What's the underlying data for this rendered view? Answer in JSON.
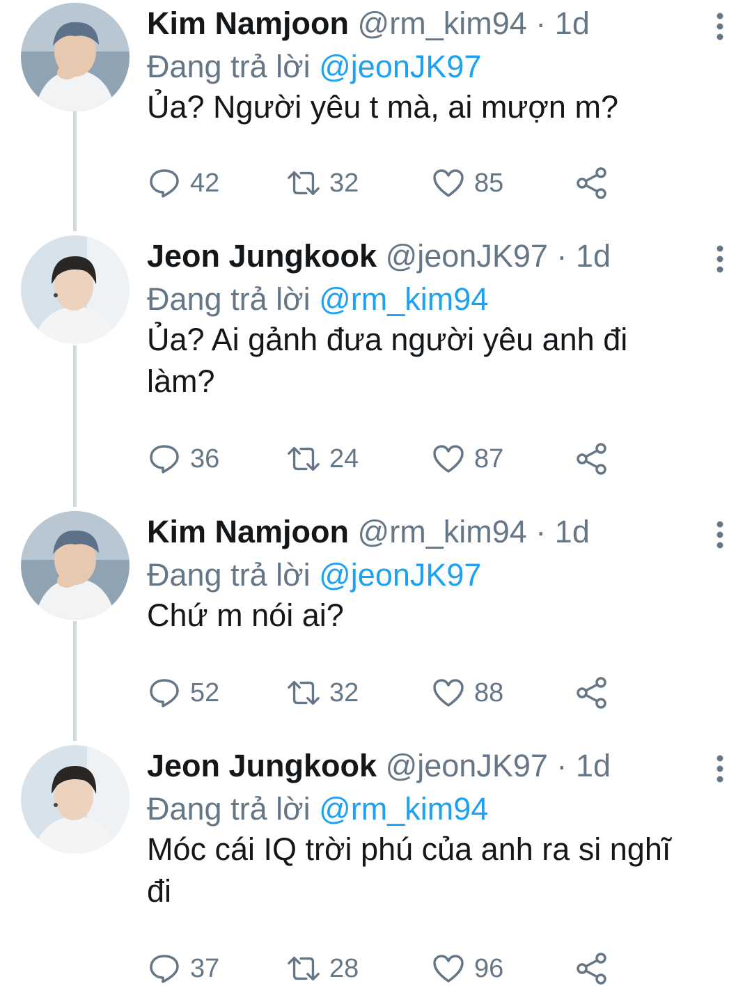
{
  "tweets": [
    {
      "name": "Kim Namjoon",
      "handle": "@rm_kim94",
      "separator": "·",
      "time": "1d",
      "reply_prefix": "Đang trả lời",
      "reply_to": "@jeonJK97",
      "text": "Ủa? Người yêu t mà, ai mượn m?",
      "replies": "42",
      "retweets": "32",
      "likes": "85",
      "avatar": "avatar-namjoon"
    },
    {
      "name": "Jeon Jungkook",
      "handle": "@jeonJK97",
      "separator": "·",
      "time": "1d",
      "reply_prefix": "Đang trả lời",
      "reply_to": "@rm_kim94",
      "text": "Ủa? Ai gảnh đưa người yêu anh đi làm?",
      "replies": "36",
      "retweets": "24",
      "likes": "87",
      "avatar": "avatar-jungkook"
    },
    {
      "name": "Kim Namjoon",
      "handle": "@rm_kim94",
      "separator": "·",
      "time": "1d",
      "reply_prefix": "Đang trả lời",
      "reply_to": "@jeonJK97",
      "text": "Chứ m nói ai?",
      "replies": "52",
      "retweets": "32",
      "likes": "88",
      "avatar": "avatar-namjoon"
    },
    {
      "name": "Jeon Jungkook",
      "handle": "@jeonJK97",
      "separator": "·",
      "time": "1d",
      "reply_prefix": "Đang trả lời",
      "reply_to": "@rm_kim94",
      "text": "Móc cái IQ trời phú của anh ra si nghĩ đi",
      "replies": "37",
      "retweets": "28",
      "likes": "96",
      "avatar": "avatar-jungkook"
    }
  ],
  "icons": {
    "reply": "reply-icon",
    "retweet": "retweet-icon",
    "like": "heart-icon",
    "share": "share-icon",
    "more": "more-options-icon"
  },
  "colors": {
    "text": "#14171a",
    "secondary": "#657786",
    "mention": "#1da1f2",
    "thread_line": "#cfd9de"
  }
}
